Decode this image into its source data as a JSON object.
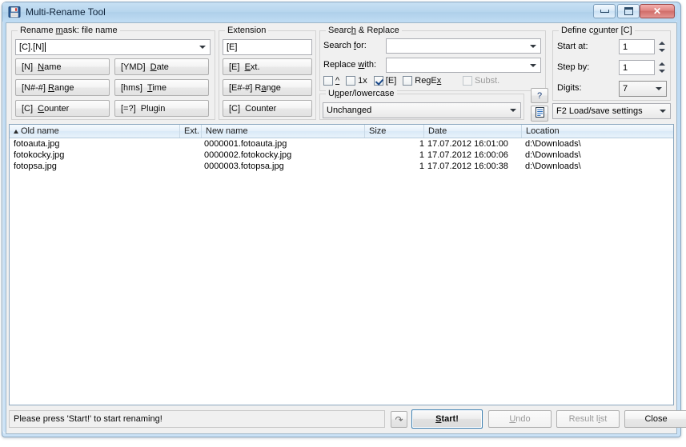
{
  "window": {
    "title": "Multi-Rename Tool",
    "icon": "floppy-disk-icon",
    "buttons": {
      "minimize": "minimize",
      "maximize": "maximize",
      "close": "close"
    }
  },
  "rename_mask": {
    "legend_prefix": "Rename ",
    "legend_acc": "m",
    "legend_suffix": "ask: file name",
    "value": "[C].[N]",
    "buttons": [
      {
        "tag": "[N]",
        "acc_before": "",
        "acc": "N",
        "acc_after": "ame"
      },
      {
        "tag": "[YMD]",
        "acc_before": "",
        "acc": "D",
        "acc_after": "ate"
      },
      {
        "tag": "[N#-#]",
        "acc_before": "",
        "acc": "R",
        "acc_after": "ange"
      },
      {
        "tag": "[hms]",
        "acc_before": "",
        "acc": "T",
        "acc_after": "ime"
      },
      {
        "tag": "[C]",
        "acc_before": "",
        "acc": "C",
        "acc_after": "ounter"
      },
      {
        "tag": "[=?]",
        "acc_before": "Plu",
        "acc": "g",
        "acc_after": "in"
      }
    ],
    "button_labels": [
      "[N]  Name",
      "[YMD]  Date",
      "[N#-#] Range",
      "[hms]  Time",
      "[C]  Counter",
      "[=?]  Plugin"
    ]
  },
  "extension": {
    "legend": "Extension",
    "value": "[E]",
    "buttons": [
      {
        "tag": "[E]",
        "pre": "",
        "acc": "E",
        "post": "xt."
      },
      {
        "tag": "[E#-#]",
        "pre": "R",
        "acc": "a",
        "post": "nge"
      },
      {
        "tag": "[C]",
        "pre": "",
        "acc": "",
        "post": "Counter"
      }
    ],
    "button_labels": [
      "[E]  Ext.",
      "[E#-#] Range",
      "[C]  Counter"
    ]
  },
  "search_replace": {
    "legend_pre": "Searc",
    "legend_acc": "h",
    "legend_post": " & Replace",
    "search_for_label_pre": "Search ",
    "search_for_label_acc": "f",
    "search_for_label_post": "or:",
    "search_for_value": "",
    "replace_with_label_pre": "Replace ",
    "replace_with_label_acc": "w",
    "replace_with_label_post": "ith:",
    "replace_with_value": "",
    "checkboxes": [
      {
        "name": "caret",
        "label": "^",
        "checked": false,
        "enabled": true
      },
      {
        "name": "1x",
        "label": "1x",
        "checked": false,
        "enabled": true
      },
      {
        "name": "E",
        "label": "[E]",
        "checked": true,
        "enabled": true
      },
      {
        "name": "RegEx",
        "label": "RegEx",
        "checked": false,
        "enabled": true
      },
      {
        "name": "Subst",
        "label": "Subst.",
        "checked": false,
        "enabled": false
      }
    ]
  },
  "upper_lower": {
    "legend_pre": "U",
    "legend_acc": "p",
    "legend_post": "per/lowercase",
    "value": "Unchanged",
    "help_button": "?",
    "list_button": "list-icon"
  },
  "define_counter": {
    "legend_pre": "Define c",
    "legend_acc": "o",
    "legend_post": "unter [C]",
    "start_at_label": "Start at:",
    "start_at_value": "1",
    "step_by_label": "Step by:",
    "step_by_value": "1",
    "digits_label": "Digits:",
    "digits_value": "7",
    "load_save": "F2 Load/save settings"
  },
  "filelist": {
    "columns": [
      {
        "key": "old_name",
        "label": "Old name",
        "sorted": true
      },
      {
        "key": "ext",
        "label": "Ext.",
        "sorted": false
      },
      {
        "key": "new_name",
        "label": "New name",
        "sorted": false
      },
      {
        "key": "size",
        "label": "Size",
        "sorted": false
      },
      {
        "key": "date",
        "label": "Date",
        "sorted": false
      },
      {
        "key": "location",
        "label": "Location",
        "sorted": false
      }
    ],
    "rows": [
      {
        "old_name": "fotoauta.jpg",
        "ext": "",
        "new_name": "0000001.fotoauta.jpg",
        "size": "1",
        "date": "17.07.2012 16:01:00",
        "location": "d:\\Downloads\\"
      },
      {
        "old_name": "fotokocky.jpg",
        "ext": "",
        "new_name": "0000002.fotokocky.jpg",
        "size": "1",
        "date": "17.07.2012 16:00:06",
        "location": "d:\\Downloads\\"
      },
      {
        "old_name": "fotopsa.jpg",
        "ext": "",
        "new_name": "0000003.fotopsa.jpg",
        "size": "1",
        "date": "17.07.2012 16:00:38",
        "location": "d:\\Downloads\\"
      }
    ]
  },
  "statusbar": {
    "message": "Please press 'Start!' to start renaming!",
    "refresh_button": "redo-icon",
    "buttons": [
      {
        "name": "start",
        "pre": "",
        "acc": "S",
        "post": "tart!",
        "label": "Start!",
        "enabled": true,
        "default": true
      },
      {
        "name": "undo",
        "pre": "",
        "acc": "U",
        "post": "ndo",
        "label": "Undo",
        "enabled": false,
        "default": false
      },
      {
        "name": "result-list",
        "pre": "Result ",
        "acc": "l",
        "post": "ist",
        "label": "Result list",
        "enabled": false,
        "default": false
      },
      {
        "name": "close",
        "pre": "",
        "acc": "",
        "post": "Close",
        "label": "Close",
        "enabled": true,
        "default": false
      }
    ]
  },
  "colors": {
    "title_bar": "#b8d6ee",
    "frame_border": "#8ba7bf",
    "client_bg": "#f0f0f0",
    "accent_blue": "#3c7fb1",
    "close_red": "#d06c68",
    "list_bg": "#ffffff",
    "group_border": "#d2d2d2"
  }
}
